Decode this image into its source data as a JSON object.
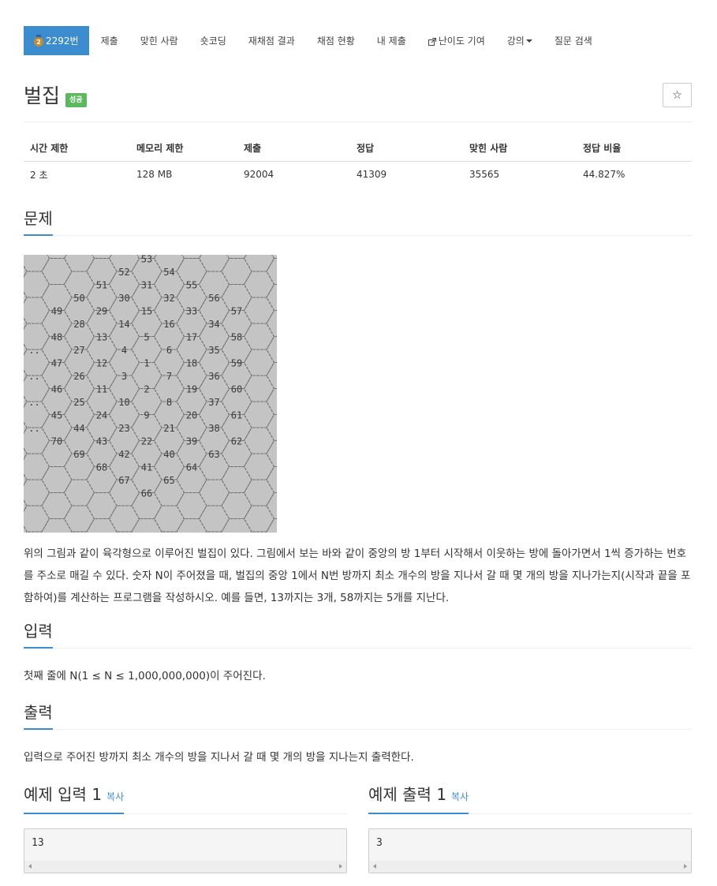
{
  "nav": {
    "problem_number": "2292번",
    "medal_level": "2",
    "items": [
      "제출",
      "맞힌 사람",
      "숏코딩",
      "재채점 결과",
      "채점 현황",
      "내 제출",
      "난이도 기여",
      "강의",
      "질문 검색"
    ]
  },
  "problem": {
    "title": "벌집",
    "badge": "성공",
    "star": "☆"
  },
  "info_table": {
    "headers": [
      "시간 제한",
      "메모리 제한",
      "제출",
      "정답",
      "맞힌 사람",
      "정답 비율"
    ],
    "values": [
      "2 초",
      "128 MB",
      "92004",
      "41309",
      "35565",
      "44.827%"
    ]
  },
  "sections": {
    "problem_heading": "문제",
    "problem_text": "위의 그림과 같이 육각형으로 이루어진 벌집이 있다. 그림에서 보는 바와 같이 중앙의 방 1부터 시작해서 이웃하는 방에 돌아가면서 1씩 증가하는 번호를 주소로 매길 수 있다. 숫자 N이 주어졌을 때, 벌집의 중앙 1에서 N번 방까지 최소 개수의 방을 지나서 갈 때 몇 개의 방을 지나가는지(시작과 끝을 포함하여)를 계산하는 프로그램을 작성하시오. 예를 들면, 13까지는 3개, 58까지는 5개를 지난다.",
    "input_heading": "입력",
    "input_text": "첫째 줄에 N(1 ≤ N ≤ 1,000,000,000)이 주어진다.",
    "output_heading": "출력",
    "output_text": "입력으로 주어진 방까지 최소 개수의 방을 지나서 갈 때 몇 개의 방을 지나는지 출력한다."
  },
  "samples": {
    "input_heading": "예제 입력 1",
    "output_heading": "예제 출력 1",
    "copy_label": "복사",
    "input_value": "13",
    "output_value": "3"
  },
  "figure": {
    "cells": [
      [
        "53",
        "",
        ""
      ],
      [
        "52",
        "",
        ""
      ],
      [
        "54",
        "",
        ""
      ],
      [
        "51",
        "",
        ""
      ],
      [
        "31",
        "",
        ""
      ],
      [
        "55",
        "",
        ""
      ],
      [
        "50",
        "",
        ""
      ],
      [
        "30",
        "",
        ""
      ],
      [
        "32",
        "",
        ""
      ],
      [
        "56",
        "",
        ""
      ],
      [
        "49",
        "",
        ""
      ],
      [
        "29",
        "",
        ""
      ],
      [
        "15",
        "",
        ""
      ],
      [
        "33",
        "",
        ""
      ],
      [
        "57",
        "",
        ""
      ],
      [
        "28",
        "",
        ""
      ],
      [
        "14",
        "",
        ""
      ],
      [
        "16",
        "",
        ""
      ],
      [
        "34",
        "",
        ""
      ],
      [
        "48",
        "",
        ""
      ],
      [
        "13",
        "",
        ""
      ],
      [
        "5",
        "",
        ""
      ],
      [
        "17",
        "",
        ""
      ],
      [
        "58",
        "",
        ""
      ],
      [
        "..",
        "",
        ""
      ],
      [
        "27",
        "",
        ""
      ],
      [
        "4",
        "",
        ""
      ],
      [
        "6",
        "",
        ""
      ],
      [
        "35",
        "",
        ""
      ],
      [
        "47",
        "",
        ""
      ],
      [
        "12",
        "",
        ""
      ],
      [
        "1",
        "",
        ""
      ],
      [
        "18",
        "",
        ""
      ],
      [
        "59",
        "",
        ""
      ],
      [
        "..",
        "",
        ""
      ],
      [
        "26",
        "",
        ""
      ],
      [
        "3",
        "",
        ""
      ],
      [
        "7",
        "",
        ""
      ],
      [
        "36",
        "",
        ""
      ],
      [
        "46",
        "",
        ""
      ],
      [
        "11",
        "",
        ""
      ],
      [
        "2",
        "",
        ""
      ],
      [
        "19",
        "",
        ""
      ],
      [
        "60",
        "",
        ""
      ],
      [
        "..",
        "",
        ""
      ],
      [
        "25",
        "",
        ""
      ],
      [
        "10",
        "",
        ""
      ],
      [
        "8",
        "",
        ""
      ],
      [
        "37",
        "",
        ""
      ],
      [
        "45",
        "",
        ""
      ],
      [
        "24",
        "",
        ""
      ],
      [
        "9",
        "",
        ""
      ],
      [
        "20",
        "",
        ""
      ],
      [
        "61",
        "",
        ""
      ],
      [
        "..",
        "",
        ""
      ],
      [
        "44",
        "",
        ""
      ],
      [
        "23",
        "",
        ""
      ],
      [
        "21",
        "",
        ""
      ],
      [
        "38",
        "",
        ""
      ],
      [
        "70",
        "",
        ""
      ],
      [
        "43",
        "",
        ""
      ],
      [
        "22",
        "",
        ""
      ],
      [
        "39",
        "",
        ""
      ],
      [
        "62",
        "",
        ""
      ],
      [
        "69",
        "",
        ""
      ],
      [
        "42",
        "",
        ""
      ],
      [
        "40",
        "",
        ""
      ],
      [
        "63",
        "",
        ""
      ],
      [
        "68",
        "",
        ""
      ],
      [
        "41",
        "",
        ""
      ],
      [
        "64",
        "",
        ""
      ],
      [
        "67",
        "",
        ""
      ],
      [
        "65",
        "",
        ""
      ],
      [
        "66",
        "",
        ""
      ]
    ]
  },
  "colors": {
    "accent": "#3c8dd0",
    "badge_success": "#5cb85c",
    "figure_bg": "#c4c4c4"
  }
}
